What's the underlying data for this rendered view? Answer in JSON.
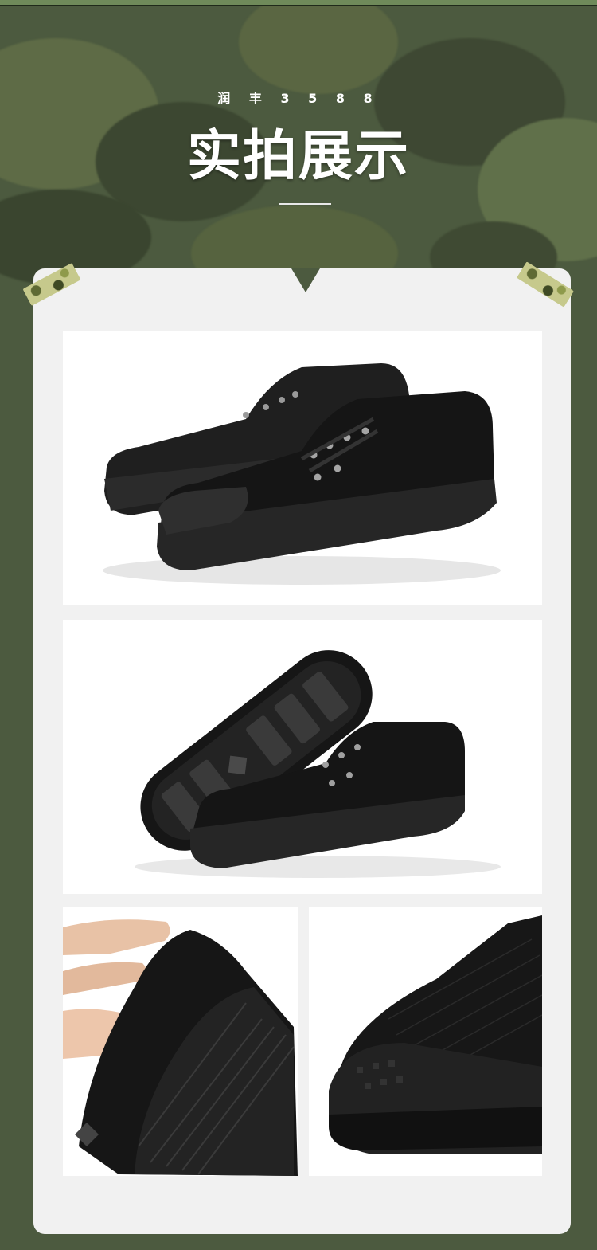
{
  "header": {
    "brand": "润 丰 3 5 8 8",
    "title": "实拍展示"
  },
  "colors": {
    "background": "#4c5a3f",
    "panel": "#f1f1f1",
    "shoe": "#1b1b1b"
  },
  "photos": [
    {
      "name": "shoe-pair-side-view"
    },
    {
      "name": "shoe-sole-and-side-view"
    },
    {
      "name": "shoe-flex-in-hand"
    },
    {
      "name": "shoe-toe-closeup"
    }
  ]
}
